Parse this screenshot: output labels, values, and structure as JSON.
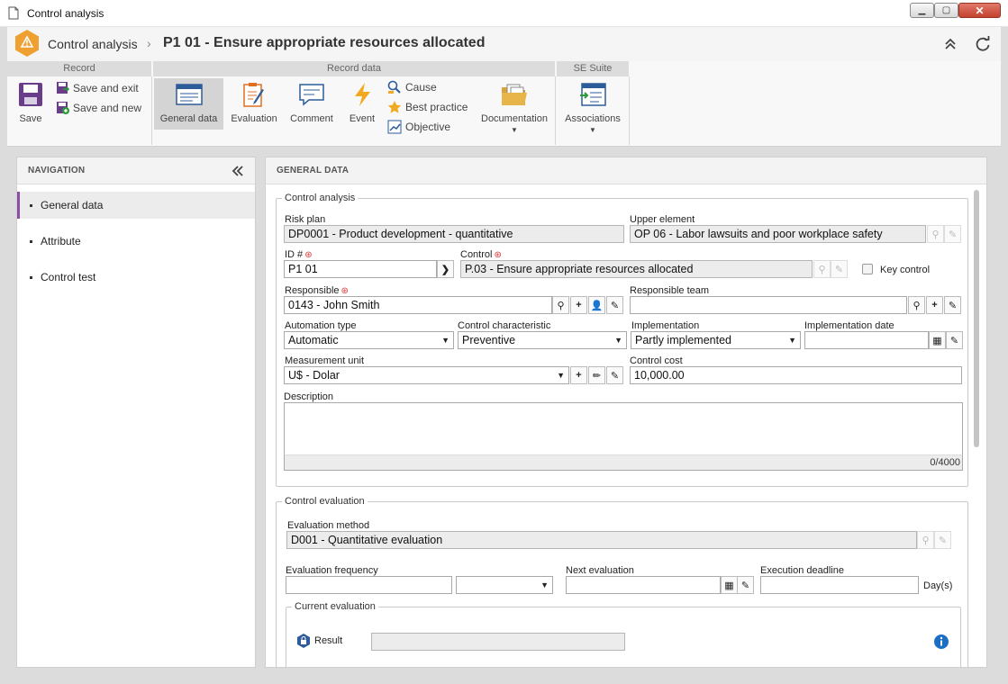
{
  "window": {
    "title": "Control analysis"
  },
  "header": {
    "crumb": "Control analysis",
    "separator": "›",
    "title": "P1 01 - Ensure appropriate resources allocated"
  },
  "ribbon": {
    "groups": {
      "record": "Record",
      "record_data": "Record data",
      "se_suite": "SE Suite"
    },
    "save": "Save",
    "save_exit": "Save and exit",
    "save_new": "Save and new",
    "general_data": "General data",
    "evaluation": "Evaluation",
    "comment": "Comment",
    "event": "Event",
    "cause": "Cause",
    "best_practice": "Best practice",
    "objective": "Objective",
    "documentation": "Documentation",
    "associations": "Associations"
  },
  "navigation": {
    "title": "NAVIGATION",
    "items": [
      "General data",
      "Attribute",
      "Control test"
    ]
  },
  "main": {
    "title": "GENERAL DATA"
  },
  "control_analysis": {
    "legend": "Control analysis",
    "risk_plan_label": "Risk plan",
    "risk_plan": "DP0001 - Product development - quantitative",
    "upper_element_label": "Upper element",
    "upper_element": "OP 06 - Labor lawsuits and poor workplace safety",
    "id_label": "ID #",
    "id": "P1 01",
    "control_label": "Control",
    "control": "P.03 - Ensure appropriate resources allocated",
    "key_control_label": "Key control",
    "responsible_label": "Responsible",
    "responsible": "0143 - John Smith",
    "responsible_team_label": "Responsible team",
    "responsible_team": "",
    "automation_type_label": "Automation type",
    "automation_type": "Automatic",
    "control_characteristic_label": "Control characteristic",
    "control_characteristic": "Preventive",
    "implementation_label": "Implementation",
    "implementation": "Partly implemented",
    "implementation_date_label": "Implementation date",
    "implementation_date": "",
    "measurement_unit_label": "Measurement unit",
    "measurement_unit": "U$ - Dolar",
    "control_cost_label": "Control cost",
    "control_cost": "10,000.00",
    "description_label": "Description",
    "description": "",
    "char_count": "0/4000"
  },
  "control_evaluation": {
    "legend": "Control evaluation",
    "evaluation_method_label": "Evaluation method",
    "evaluation_method": "D001 - Quantitative evaluation",
    "evaluation_frequency_label": "Evaluation frequency",
    "evaluation_frequency": "",
    "frequency_unit": "",
    "next_evaluation_label": "Next evaluation",
    "next_evaluation": "",
    "execution_deadline_label": "Execution deadline",
    "execution_deadline": "",
    "deadline_unit": "Day(s)",
    "current_evaluation_legend": "Current evaluation",
    "result_label": "Result",
    "result": ""
  },
  "colors": {
    "accent": "#8a4fa3",
    "warning_badge": "#f0a030",
    "info": "#1a6fc4"
  }
}
